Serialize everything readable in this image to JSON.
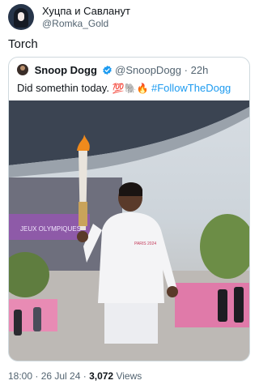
{
  "author": {
    "display_name": "Хуцпа и Савланут",
    "handle": "@Romka_Gold"
  },
  "tweet": {
    "text": "Torch"
  },
  "quoted": {
    "display_name": "Snoop Dogg",
    "handle": "@SnoopDogg",
    "separator": "·",
    "time": "22h",
    "text_before": "Did somethin today.",
    "emoji": "💯🐘🔥",
    "hashtag": "#FollowTheDogg",
    "photo_shirt_text": "PARIS 2024",
    "photo_banner_text": "JEUX OLYMPIQUES"
  },
  "meta": {
    "timestamp": "18:00 · 26 Jul 24 ·",
    "views_count": "3,072",
    "views_label": "Views"
  },
  "colors": {
    "text": "#0f1419",
    "secondary": "#536471",
    "link": "#1d9bf0",
    "border": "#cfd9de"
  }
}
